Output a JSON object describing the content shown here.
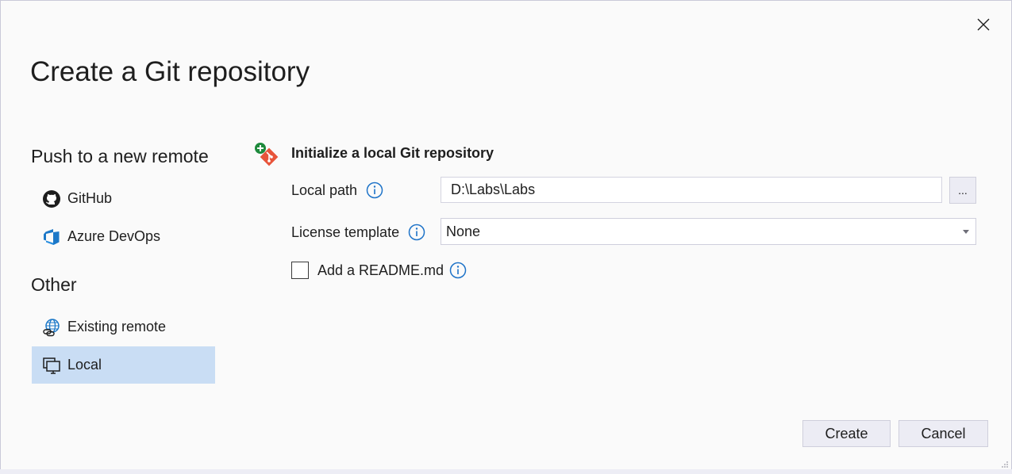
{
  "dialog": {
    "title": "Create a Git repository"
  },
  "sidebar": {
    "push_heading": "Push to a new remote",
    "other_heading": "Other",
    "items": [
      {
        "label": "GitHub",
        "icon": "github-icon"
      },
      {
        "label": "Azure DevOps",
        "icon": "azure-devops-icon"
      },
      {
        "label": "Existing remote",
        "icon": "globe-link-icon"
      },
      {
        "label": "Local",
        "icon": "local-computer-icon",
        "selected": true
      }
    ]
  },
  "main": {
    "heading": "Initialize a local Git repository",
    "local_path_label": "Local path",
    "local_path_value": "D:\\Labs\\Labs",
    "browse_label": "...",
    "license_label": "License template",
    "license_value": "None",
    "readme_label": "Add a README.md",
    "readme_checked": false
  },
  "footer": {
    "create_label": "Create",
    "cancel_label": "Cancel"
  },
  "colors": {
    "accent": "#1e73c8",
    "selected_bg": "#c9ddf4",
    "git_orange": "#e8543a",
    "plus_green": "#1e8a3c"
  }
}
